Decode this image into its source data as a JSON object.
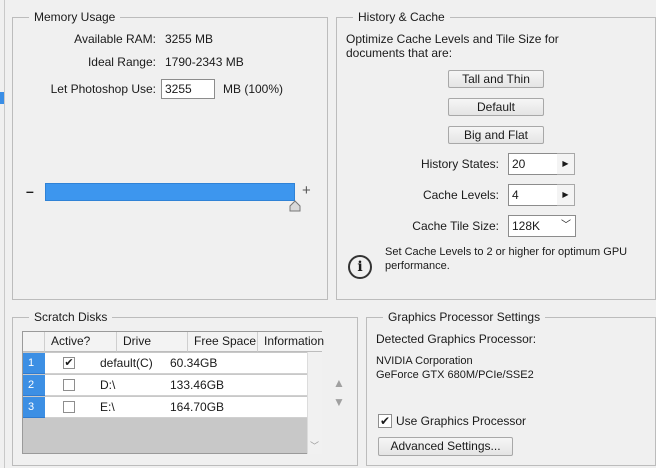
{
  "memory": {
    "legend": "Memory Usage",
    "available_label": "Available RAM:",
    "available_value": "3255 MB",
    "ideal_label": "Ideal Range:",
    "ideal_value": "1790-2343 MB",
    "let_label": "Let Photoshop Use:",
    "let_value": "3255",
    "let_unit": "MB (100%)",
    "minus": "–",
    "plus": "+",
    "slider_fraction": 1.0
  },
  "history": {
    "legend": "History & Cache",
    "description": "Optimize Cache Levels and Tile Size for documents that are:",
    "tall_thin": "Tall and Thin",
    "default": "Default",
    "big_flat": "Big and Flat",
    "states_label": "History States:",
    "states_value": "20",
    "levels_label": "Cache Levels:",
    "levels_value": "4",
    "tile_label": "Cache Tile Size:",
    "tile_value": "128K",
    "info": "Set Cache Levels to 2 or higher for optimum GPU performance.",
    "info_icon": "i"
  },
  "scratch": {
    "legend": "Scratch Disks",
    "columns": [
      "Active?",
      "Drive",
      "Free Space",
      "Information"
    ],
    "rows": [
      {
        "num": "1",
        "active": "✔",
        "drive": "default(C)",
        "free": "60.34GB",
        "info": ""
      },
      {
        "num": "2",
        "active": "",
        "drive": "D:\\",
        "free": "133.46GB",
        "info": ""
      },
      {
        "num": "3",
        "active": "",
        "drive": "E:\\",
        "free": "164.70GB",
        "info": ""
      }
    ]
  },
  "gpu": {
    "legend": "Graphics Processor Settings",
    "detected_label": "Detected Graphics Processor:",
    "vendor": "NVIDIA Corporation",
    "model": "GeForce GTX 680M/PCIe/SSE2",
    "use_label": "Use Graphics Processor",
    "use_checked": "✔",
    "advanced": "Advanced Settings..."
  },
  "colors": {
    "accent": "#3d96ee",
    "background": "#f0f0f0"
  }
}
